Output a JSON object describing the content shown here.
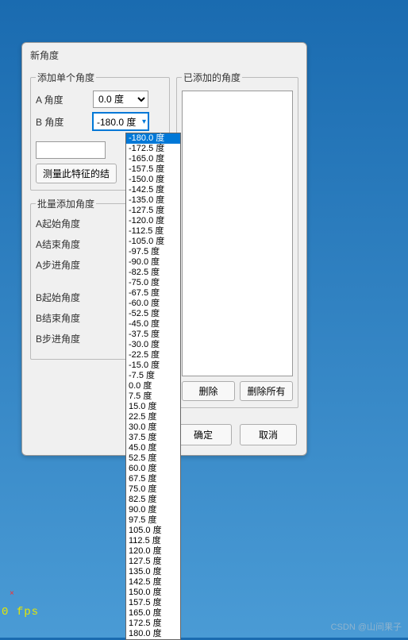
{
  "dialog": {
    "title": "新角度",
    "single_group": "添加单个角度",
    "a_label": "A 角度",
    "b_label": "B 角度",
    "a_value": "0.0 度",
    "b_value": "-180.0 度",
    "measure_btn": "测量此特征的结",
    "batch_group": "批量添加角度",
    "a_start": "A起始角度",
    "a_end": "A结束角度",
    "a_step": "A步进角度",
    "b_start": "B起始角度",
    "b_end": "B结束角度",
    "b_step": "B步进角度",
    "added_group": "已添加的角度",
    "delete_btn": "删除",
    "delete_all_btn": "删除所有",
    "ok_btn": "确定",
    "cancel_btn": "取消"
  },
  "dropdown": {
    "items": [
      "-180.0 度",
      "-172.5 度",
      "-165.0 度",
      "-157.5 度",
      "-150.0 度",
      "-142.5 度",
      "-135.0 度",
      "-127.5 度",
      "-120.0 度",
      "-112.5 度",
      "-105.0 度",
      "-97.5 度",
      "-90.0 度",
      "-82.5 度",
      "-75.0 度",
      "-67.5 度",
      "-60.0 度",
      "-52.5 度",
      "-45.0 度",
      "-37.5 度",
      "-30.0 度",
      "-22.5 度",
      "-15.0 度",
      "-7.5 度",
      "0.0 度",
      "7.5 度",
      "15.0 度",
      "22.5 度",
      "30.0 度",
      "37.5 度",
      "45.0 度",
      "52.5 度",
      "60.0 度",
      "67.5 度",
      "75.0 度",
      "82.5 度",
      "90.0 度",
      "97.5 度",
      "105.0 度",
      "112.5 度",
      "120.0 度",
      "127.5 度",
      "135.0 度",
      "142.5 度",
      "150.0 度",
      "157.5 度",
      "165.0 度",
      "172.5 度",
      "180.0 度"
    ],
    "selected_index": 0
  },
  "fps": {
    "value": "0",
    "unit": "fps"
  },
  "red_x": "×",
  "watermark": "CSDN @山间果子"
}
